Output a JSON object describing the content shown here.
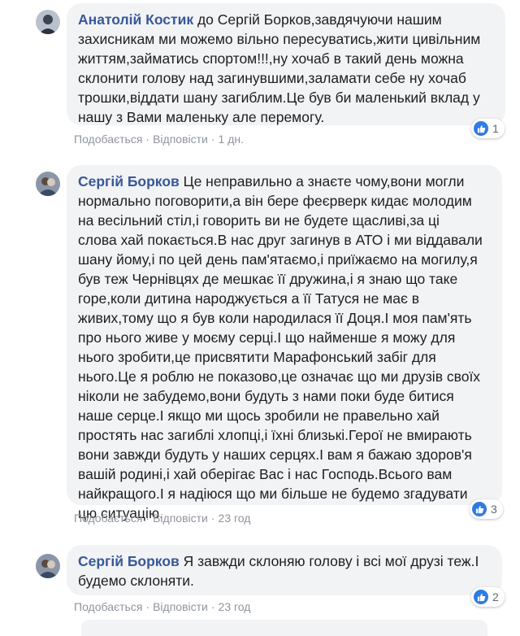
{
  "comments": [
    {
      "author": "Анатолій Костик",
      "lines": [
        "до Сергій Борков,завдячуючи нашим",
        "захисникам ми можемо вільно пересуватись,жити цивільним",
        "життям,займатись спортом!!!,ну хочаб в такий день можна",
        "склонити голову над загинувшими,заламати себе ну хочаб",
        "трошки,віддати шану загиблим.Це був би маленький вклад у",
        "нашу з Вами маленьку але перемогу."
      ],
      "like": "Подобається",
      "reply": "Відповісти",
      "time": "1 дн.",
      "reactions": "1"
    },
    {
      "author": "Сергій Борков",
      "lines": [
        "Це неправильно а знаєте чому,вони могли",
        "нормально поговорити,а він бере феєрверк кидає молодим",
        "на весільний стіл,і говорить ви не будете щасливі,за ці",
        "слова хай покається.В нас друг загинув в АТО і ми віддавали",
        "шану йому,і по цей день пам'ятаємо,і приїжаємо на могилу,я",
        "був теж Чернівцях де мешкає її дружина,і я знаю що таке",
        "горе,коли дитина народжується а її Татуся не має в",
        "живих,тому що я був коли народилася її Доця.І моя пам'ять",
        "про нього живе у моєму серці.І що найменше я можу для",
        "нього зробити,це присвятити Марафонський забіг для",
        "нього.Це я роблю не показово,це означає що ми друзів своїх",
        "ніколи не забудемо,вони будуть з нами поки буде битися",
        "наше серце.І якщо ми щось зробили не правельно хай",
        "простять нас загиблі хлопці,і їхні близькі.Герої не вмирають",
        "вони завжди будуть у наших серцях.І вам я бажаю здоров'я",
        "вашій родині,і хай оберігає Вас і нас Господь.Всього вам",
        "найкращого.І я надіюся що ми більше не будемо згадувати",
        "цю ситуацію."
      ],
      "like": "Подобається",
      "reply": "Відповісти",
      "time": "23 год",
      "reactions": "3"
    },
    {
      "author": "Сергій Борков",
      "lines": [
        "Я завжди склоняю голову і всі мої друзі теж.І",
        "будемо склоняти."
      ],
      "like": "Подобається",
      "reply": "Відповісти",
      "time": "23 год",
      "reactions": "2"
    }
  ],
  "colors": {
    "author": "#385898",
    "bubble": "#f2f3f5",
    "meta": "#90949c",
    "like": "#2e7be4"
  },
  "icons": [
    "avatar",
    "thumbs-up-icon"
  ]
}
